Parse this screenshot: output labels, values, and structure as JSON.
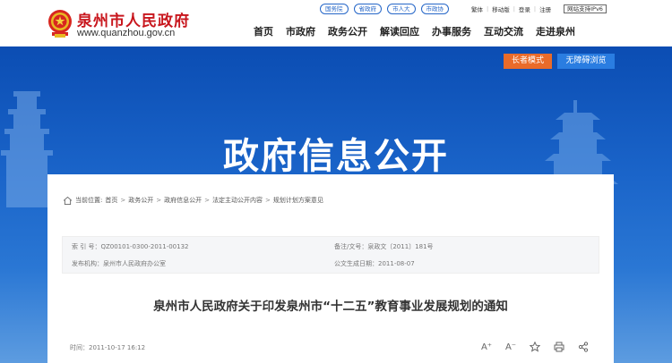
{
  "header": {
    "site_name": "泉州市人民政府",
    "site_url": "www.quanzhou.gov.cn",
    "top_links": [
      "国务院",
      "省政府",
      "市人大",
      "市政协"
    ],
    "utility": {
      "traditional": "繁体",
      "mobile": "移动版",
      "login": "登录",
      "register": "注册",
      "ipv6": "网站支持IPv6"
    },
    "nav": [
      "首页",
      "市政府",
      "政务公开",
      "解读回应",
      "办事服务",
      "互动交流",
      "走进泉州"
    ],
    "brand_color": "#c8161d"
  },
  "banner": {
    "title": "政府信息公开",
    "elder_mode": "长者模式",
    "accessible": "无障碍浏览"
  },
  "breadcrumb": {
    "label": "当前位置:",
    "items": [
      "首页",
      "政务公开",
      "政府信息公开",
      "法定主动公开内容",
      "规划计划方案意见"
    ]
  },
  "meta": {
    "index_no": "索 引 号：QZ00101-0300-2011-00132",
    "doc_no": "备注/文号：泉政文〔2011〕181号",
    "publisher": "发布机构：泉州市人民政府办公室",
    "generated": "公文生成日期：2011-08-07"
  },
  "document": {
    "title": "泉州市人民政府关于印发泉州市“十二五”教育事业发展规划的通知",
    "time": "时间：2011-10-17 16:12"
  },
  "tools": {
    "font_up": "A⁺",
    "font_down": "A⁻"
  }
}
